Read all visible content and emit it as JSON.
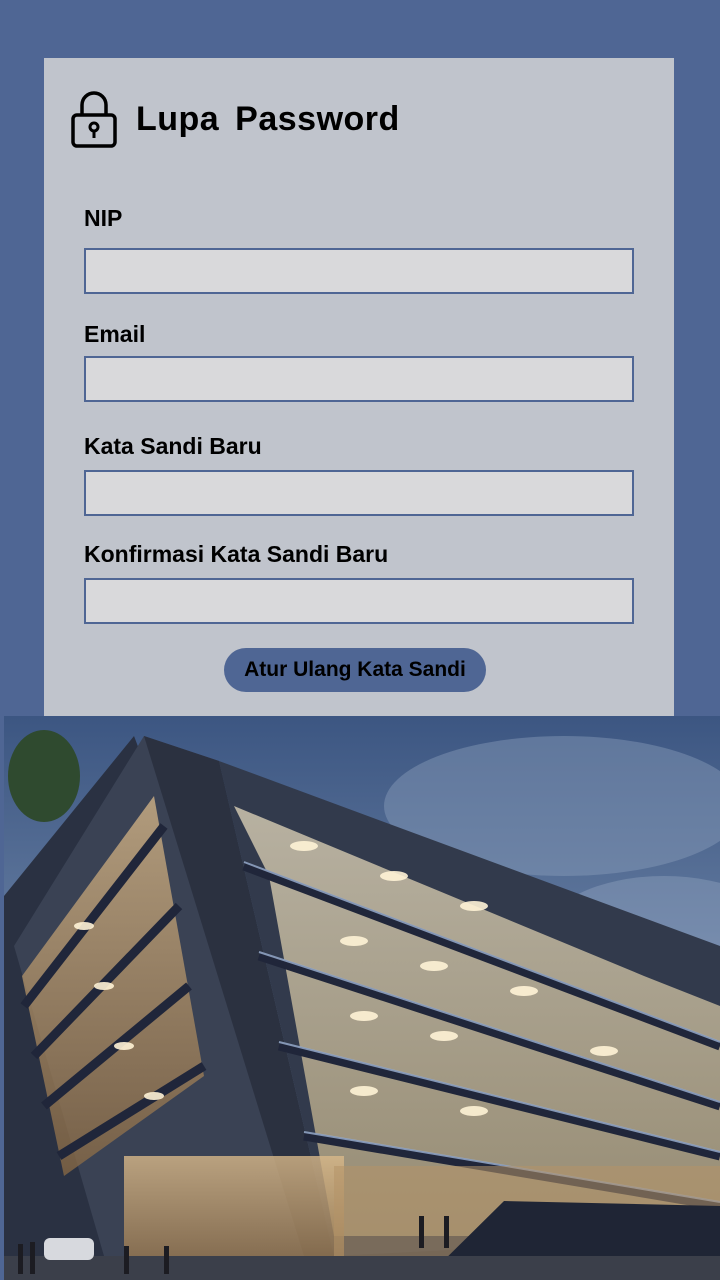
{
  "form": {
    "title": "Lupa  Password",
    "lock_icon": "lock-icon",
    "fields": [
      {
        "label": "NIP",
        "value": "",
        "placeholder": ""
      },
      {
        "label": "Email",
        "value": "",
        "placeholder": ""
      },
      {
        "label": "Kata Sandi Baru",
        "value": "",
        "placeholder": ""
      },
      {
        "label": "Konfirmasi Kata Sandi Baru",
        "value": "",
        "placeholder": ""
      }
    ],
    "submit_label": "Atur Ulang Kata Sandi"
  },
  "colors": {
    "page_background": "#4f6694",
    "card_background": "#c0c4cc",
    "input_background": "#d9d9db",
    "button_background": "#4f6694"
  },
  "image": {
    "subject": "modern-office-building-photo"
  }
}
